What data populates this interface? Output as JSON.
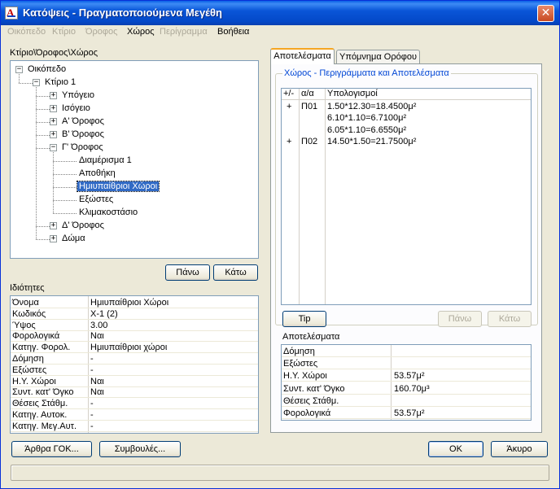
{
  "window": {
    "title": "Κατόψεις - Πραγματοποιούμενα Μεγέθη",
    "close_glyph": "✕"
  },
  "menu": [
    {
      "label": "Οικόπεδο",
      "enabled": false
    },
    {
      "label": "Κτίριο",
      "enabled": false
    },
    {
      "label": "Όροφος",
      "enabled": false
    },
    {
      "label": "Χώρος",
      "enabled": true
    },
    {
      "label": "Περίγραμμα",
      "enabled": false
    },
    {
      "label": "Βοήθεια",
      "enabled": true
    }
  ],
  "tree_section": {
    "title": "Κτίριο\\Όροφος\\Χώρος",
    "nodes": [
      {
        "label": "Οικόπεδο",
        "expander": "−"
      },
      {
        "label": "Κτίριο 1",
        "expander": "−"
      },
      {
        "label": "Υπόγειο",
        "expander": "+"
      },
      {
        "label": "Ισόγειο",
        "expander": "+"
      },
      {
        "label": "Α' Όροφος",
        "expander": "+"
      },
      {
        "label": "Β' Όροφος",
        "expander": "+"
      },
      {
        "label": "Γ' Όροφος",
        "expander": "−"
      },
      {
        "label": "Διαμέρισμα 1",
        "expander": ""
      },
      {
        "label": "Αποθήκη",
        "expander": ""
      },
      {
        "label": "Ημιυπαίθριοι Χώροι",
        "expander": "",
        "selected": true
      },
      {
        "label": "Εξώστες",
        "expander": ""
      },
      {
        "label": "Κλιμακοστάσιο",
        "expander": ""
      },
      {
        "label": "Δ' Όροφος",
        "expander": "+"
      },
      {
        "label": "Δώμα",
        "expander": "+"
      }
    ],
    "up_button": "Πάνω",
    "down_button": "Κάτω"
  },
  "properties": {
    "title": "Ιδιότητες",
    "rows": [
      {
        "name": "Όνομα",
        "value": "Ημιυπαίθριοι Χώροι"
      },
      {
        "name": "Κωδικός",
        "value": "Χ-1 (2)"
      },
      {
        "name": "Ύψος",
        "value": "3.00"
      },
      {
        "name": "Φορολογικά",
        "value": "Ναι"
      },
      {
        "name": "Κατηγ. Φορολ.",
        "value": "Ημιυπαίθριοι χώροι"
      },
      {
        "name": "Δόμηση",
        "value": "-"
      },
      {
        "name": "Εξώστες",
        "value": "-"
      },
      {
        "name": "Η.Υ. Χώροι",
        "value": "Ναι"
      },
      {
        "name": "Συντ. κατ' Όγκο",
        "value": "Ναι"
      },
      {
        "name": "Θέσεις Στάθμ.",
        "value": "-"
      },
      {
        "name": "Κατηγ. Αυτοκ.",
        "value": "-"
      },
      {
        "name": "Κατηγ. Μεγ.Αυτ.",
        "value": "-"
      }
    ]
  },
  "tabs": [
    {
      "label": "Αποτελέσματα",
      "active": true
    },
    {
      "label": "Υπόμνημα Ορόφου",
      "active": false
    }
  ],
  "calc_group": {
    "title": "Χώρος - Περιγράμματα και Αποτελέσματα",
    "headers": {
      "sign": "+/-",
      "id": "α/α",
      "calc": "Υπολογισμοί"
    },
    "rows": [
      {
        "sign": "+",
        "id": "Π01",
        "calc": "1.50*12.30=18.4500μ²"
      },
      {
        "sign": "",
        "id": "",
        "calc": "6.10*1.10=6.7100μ²"
      },
      {
        "sign": "",
        "id": "",
        "calc": "6.05*1.10=6.6550μ²"
      },
      {
        "sign": "+",
        "id": "Π02",
        "calc": "14.50*1.50=21.7500μ²"
      }
    ],
    "tip_button": "Tip",
    "up_button": "Πάνω",
    "down_button": "Κάτω"
  },
  "results": {
    "title": "Αποτελέσματα",
    "rows": [
      {
        "name": "Δόμηση",
        "value": ""
      },
      {
        "name": "Εξώστες",
        "value": ""
      },
      {
        "name": "Η.Υ. Χώροι",
        "value": "53.57μ²"
      },
      {
        "name": "Συντ. κατ' Όγκο",
        "value": "160.70μ³"
      },
      {
        "name": "Θέσεις Στάθμ.",
        "value": ""
      },
      {
        "name": "Φορολογικά",
        "value": "53.57μ²"
      }
    ]
  },
  "footer": {
    "articles_button": "Άρθρα ΓΟΚ...",
    "tips_button": "Συμβουλές...",
    "ok_button": "OK",
    "cancel_button": "Άκυρο"
  }
}
